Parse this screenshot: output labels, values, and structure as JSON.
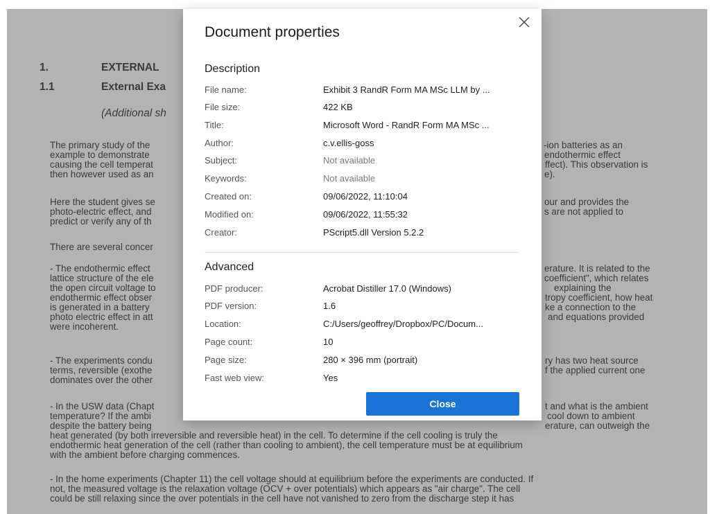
{
  "document": {
    "heading1_number": "1.",
    "heading1_text": "EXTERNAL",
    "heading11_number": "1.1",
    "heading11_text": "External Exa",
    "subheading": "(Additional sh",
    "left_lines": [
      "The primary study of the",
      "example to demonstrate",
      "causing the cell temperat",
      "then however used as an",
      "Here the student gives se",
      "photo-electric effect, and",
      "predict or verify any of th",
      "There are several concer",
      "- The endothermic effect",
      "lattice structure of the ele",
      "the open circuit voltage to",
      "endothermic effect obser",
      "is generated in a battery",
      "photo electric effect in att",
      "were incoherent.",
      "- The experiments condu",
      "terms, reversible (exothe",
      "dominates over the other",
      "- In the USW data (Chapt",
      "temperature? If the ambi",
      "despite the battery being"
    ],
    "right_lines": [
      "-ion batteries as an",
      "endothermic effect",
      "ffect). This observation is",
      "e).",
      "our and provides the",
      "s are not applied to",
      "erature. It is related to the",
      "coefficient\", which relates",
      "explaining the",
      "tropy coefficient, how heat",
      "ke a connection to the",
      "and equations provided",
      "ry has two heat source",
      "f the applied current one",
      "t and what is the ambient",
      "cool down to ambient",
      "erature, can outweigh the"
    ],
    "bottom_lines": [
      "heat generated (by both irreversible and reversible heat) in the cell. To determine if the cell cooling is truly the",
      "endothermic heat generation of the cell (rather than cooling to ambient), the cell temperature must be at equilibrium",
      "with the ambient before charging commences.",
      "- In the home experiments (Chapter 11) the cell voltage should at equilibrium before the experiments are conducted. If",
      "not, the measured voltage is the relaxation voltage (OCV + over potentials) which appears as \"air charge\". The cell",
      "could be still relaxing since the over potentials in the cell have not vanished to zero from the discharge step it has"
    ]
  },
  "dialog": {
    "title": "Document properties",
    "description_title": "Description",
    "description": [
      {
        "label": "File name:",
        "value": "Exhibit 3 RandR Form MA MSc LLM by ...",
        "na": false
      },
      {
        "label": "File size:",
        "value": "422 KB",
        "na": false
      },
      {
        "label": "Title:",
        "value": "Microsoft Word - RandR Form MA MSc ...",
        "na": false
      },
      {
        "label": "Author:",
        "value": "c.v.ellis-goss",
        "na": false
      },
      {
        "label": "Subject:",
        "value": "Not available",
        "na": true
      },
      {
        "label": "Keywords:",
        "value": "Not available",
        "na": true
      },
      {
        "label": "Created on:",
        "value": "09/06/2022, 11:10:04",
        "na": false
      },
      {
        "label": "Modified on:",
        "value": "09/06/2022, 11:55:32",
        "na": false
      },
      {
        "label": "Creator:",
        "value": "PScript5.dll Version 5.2.2",
        "na": false
      }
    ],
    "advanced_title": "Advanced",
    "advanced": [
      {
        "label": "PDF producer:",
        "value": "Acrobat Distiller 17.0 (Windows)"
      },
      {
        "label": "PDF version:",
        "value": "1.6"
      },
      {
        "label": "Location:",
        "value": "C:/Users/geoffrey/Dropbox/PC/Docum..."
      },
      {
        "label": "Page count:",
        "value": "10"
      },
      {
        "label": "Page size:",
        "value": "280 × 396 mm (portrait)"
      },
      {
        "label": "Fast web view:",
        "value": "Yes"
      }
    ],
    "close_label": "Close",
    "accent_color": "#1a73d6"
  }
}
